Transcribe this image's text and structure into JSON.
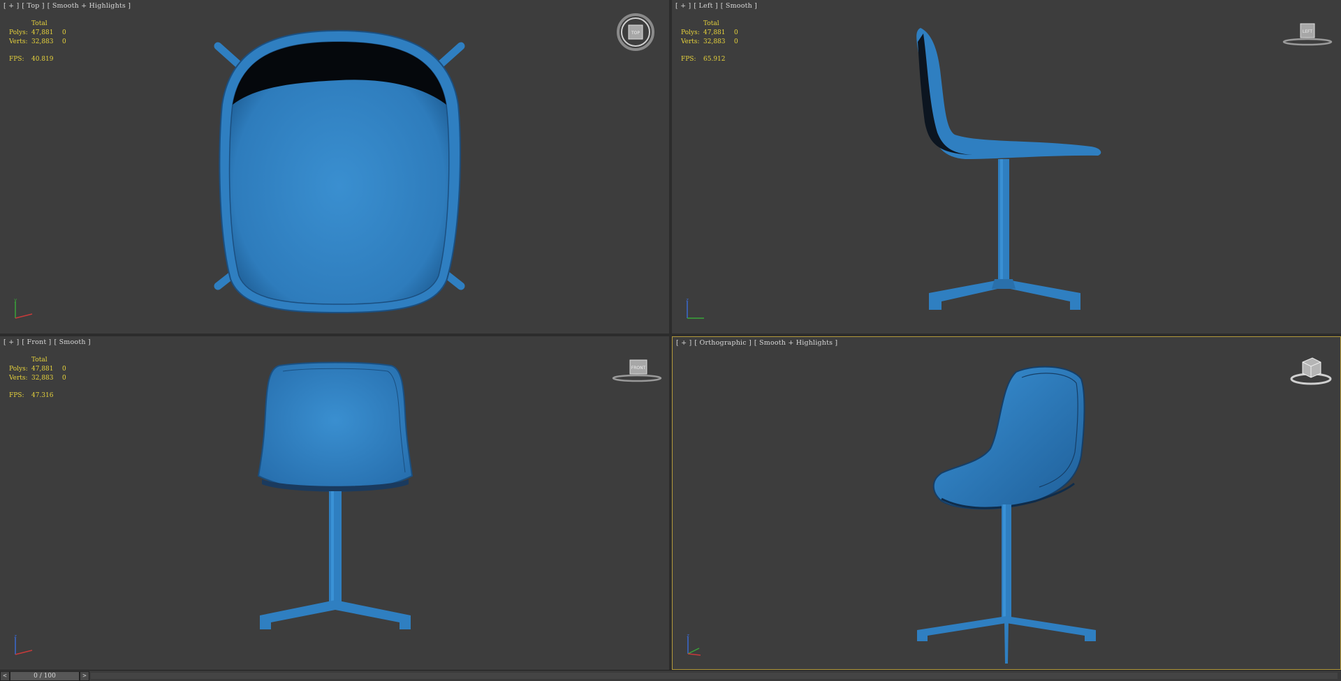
{
  "viewports": {
    "top": {
      "label": [
        "[ + ]",
        "[ Top ]",
        "[ Smooth + Highlights ]"
      ],
      "gizmo": "TOP",
      "stats": {
        "total_label": "Total",
        "polys_label": "Polys:",
        "polys": "47,881",
        "polys_sel": "0",
        "verts_label": "Verts:",
        "verts": "32,883",
        "verts_sel": "0",
        "fps_label": "FPS:",
        "fps": "40.819"
      }
    },
    "left": {
      "label": [
        "[ + ]",
        "[ Left ]",
        "[ Smooth ]"
      ],
      "gizmo": "LEFT",
      "stats": {
        "total_label": "Total",
        "polys_label": "Polys:",
        "polys": "47,881",
        "polys_sel": "0",
        "verts_label": "Verts:",
        "verts": "32,883",
        "verts_sel": "0",
        "fps_label": "FPS:",
        "fps": "65.912"
      }
    },
    "front": {
      "label": [
        "[ + ]",
        "[ Front ]",
        "[ Smooth ]"
      ],
      "gizmo": "FRONT",
      "stats": {
        "total_label": "Total",
        "polys_label": "Polys:",
        "polys": "47,881",
        "polys_sel": "0",
        "verts_label": "Verts:",
        "verts": "32,883",
        "verts_sel": "0",
        "fps_label": "FPS:",
        "fps": "47.316"
      }
    },
    "ortho": {
      "label": [
        "[ + ]",
        "[ Orthographic ]",
        "[ Smooth + Highlights ]"
      ],
      "gizmo": "CUBE"
    }
  },
  "timeline": {
    "prev": "<",
    "next": ">",
    "frame": "0 / 100"
  },
  "colors": {
    "chair": "#2f7fc1",
    "chair_dark": "#1a4f80",
    "viewport_bg": "#3d3d3d",
    "stats_text": "#e7d33c",
    "active_border": "#b49a3c"
  }
}
